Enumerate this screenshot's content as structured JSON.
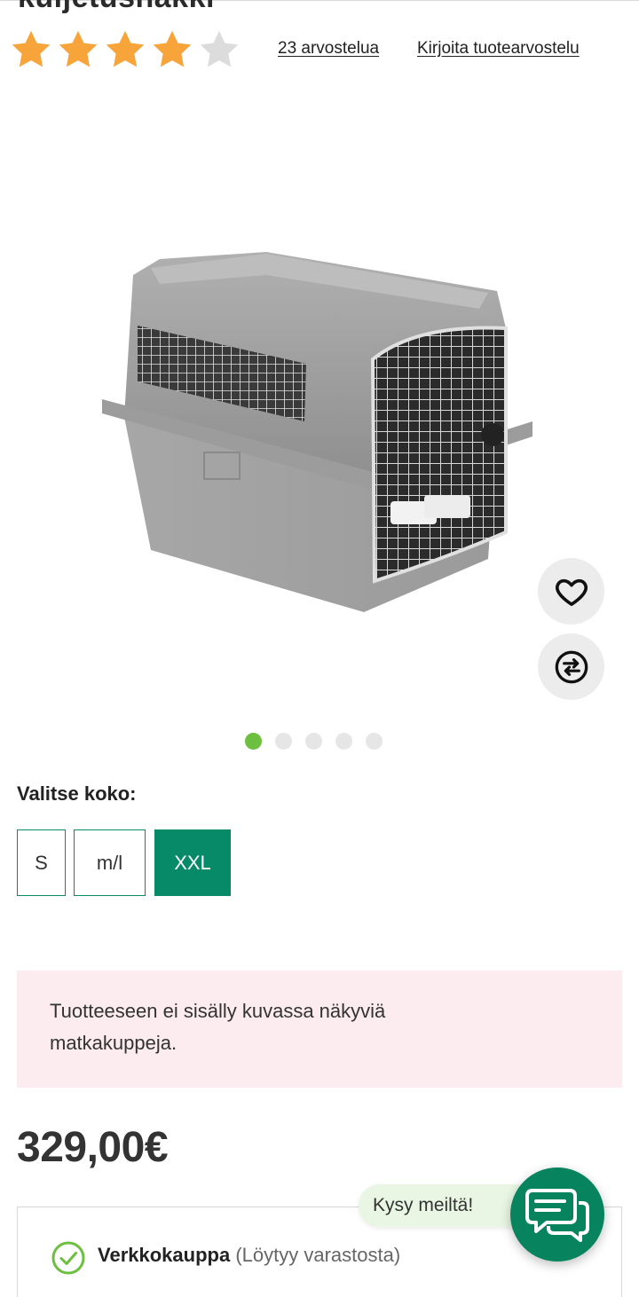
{
  "product": {
    "title_partial": "kuljetushäkki"
  },
  "rating": {
    "stars": 4,
    "max_stars": 5,
    "star_color": "#f7a53a",
    "empty_color": "#dcdcdc",
    "reviews_label": "23 arvostelua",
    "write_review_label": "Kirjoita tuotearvostelu"
  },
  "gallery": {
    "dot_count": 5,
    "active_index": 0,
    "favorite_icon": "heart-icon",
    "compare_icon": "compare-arrows-icon"
  },
  "size_selector": {
    "label": "Valitse koko:",
    "options": [
      "S",
      "m/l",
      "XXL"
    ],
    "selected": "XXL",
    "accent": "#078a68"
  },
  "notice": {
    "text": "Tuotteeseen ei sisälly kuvassa näkyviä matkakuppeja."
  },
  "price": {
    "value": "329,00€"
  },
  "availability": {
    "channel": "Verkkokauppa",
    "status": "(Löytyy varastosta)",
    "status_color": "#6cbf3f"
  },
  "chat": {
    "label": "Kysy meiltä!",
    "button_color": "#07845e"
  }
}
